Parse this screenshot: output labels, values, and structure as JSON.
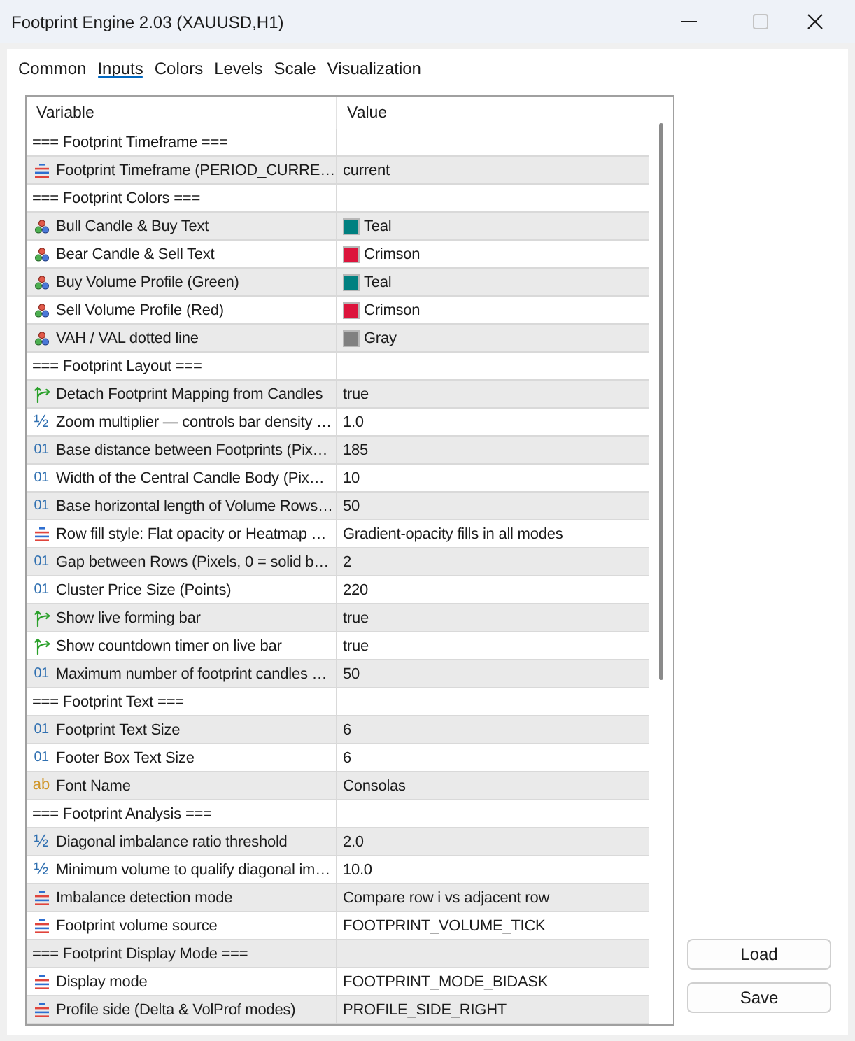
{
  "window": {
    "title": "Footprint Engine 2.03 (XAUUSD,H1)",
    "controls": [
      {
        "kind": "minimize",
        "disabled": false
      },
      {
        "kind": "maximize",
        "disabled": true
      },
      {
        "kind": "close",
        "disabled": false
      }
    ]
  },
  "tabs": [
    {
      "label": "Common",
      "selected": false
    },
    {
      "label": "Inputs",
      "selected": true
    },
    {
      "label": "Colors",
      "selected": false
    },
    {
      "label": "Levels",
      "selected": false
    },
    {
      "label": "Scale",
      "selected": false
    },
    {
      "label": "Visualization",
      "selected": false
    }
  ],
  "table": {
    "columns": [
      "Variable",
      "Value"
    ],
    "rows": [
      {
        "kind": "group",
        "variable": "=== Footprint Timeframe ==="
      },
      {
        "kind": "enum",
        "variable": "Footprint Timeframe (PERIOD_CURRE…",
        "value": "current"
      },
      {
        "kind": "group",
        "variable": "=== Footprint Colors ==="
      },
      {
        "kind": "color",
        "variable": "Bull Candle & Buy Text",
        "value": "Teal",
        "color": "#008080"
      },
      {
        "kind": "color",
        "variable": "Bear Candle & Sell Text",
        "value": "Crimson",
        "color": "#dc143c"
      },
      {
        "kind": "color",
        "variable": "Buy Volume Profile (Green)",
        "value": "Teal",
        "color": "#008080"
      },
      {
        "kind": "color",
        "variable": "Sell Volume Profile (Red)",
        "value": "Crimson",
        "color": "#dc143c"
      },
      {
        "kind": "color",
        "variable": "VAH / VAL dotted line",
        "value": "Gray",
        "color": "#808080"
      },
      {
        "kind": "group",
        "variable": "=== Footprint Layout ==="
      },
      {
        "kind": "bool",
        "variable": "Detach Footprint Mapping from Candles",
        "value": "true"
      },
      {
        "kind": "double",
        "icon": "½",
        "variable": "Zoom multiplier — controls bar density …",
        "value": "1.0"
      },
      {
        "kind": "int",
        "icon": "01",
        "variable": "Base distance between Footprints (Pix…",
        "value": "185"
      },
      {
        "kind": "int",
        "icon": "01",
        "variable": "Width of the Central Candle Body (Pix…",
        "value": "10"
      },
      {
        "kind": "int",
        "icon": "01",
        "variable": "Base horizontal length of Volume Rows…",
        "value": "50"
      },
      {
        "kind": "enum",
        "variable": "Row fill style: Flat opacity or Heatmap …",
        "value": "Gradient-opacity fills in all modes"
      },
      {
        "kind": "int",
        "icon": "01",
        "variable": "Gap between Rows (Pixels, 0 = solid b…",
        "value": "2"
      },
      {
        "kind": "int",
        "icon": "01",
        "variable": "Cluster Price Size (Points)",
        "value": "220"
      },
      {
        "kind": "bool",
        "variable": "Show live forming bar",
        "value": "true"
      },
      {
        "kind": "bool",
        "variable": "Show countdown timer on live bar",
        "value": "true"
      },
      {
        "kind": "int",
        "icon": "01",
        "variable": "Maximum number of footprint candles …",
        "value": "50"
      },
      {
        "kind": "group",
        "variable": "=== Footprint Text ==="
      },
      {
        "kind": "int",
        "icon": "01",
        "variable": "Footprint Text Size",
        "value": "6"
      },
      {
        "kind": "int",
        "icon": "01",
        "variable": "Footer Box Text Size",
        "value": "6"
      },
      {
        "kind": "string",
        "icon": "ab",
        "variable": "Font Name",
        "value": "Consolas"
      },
      {
        "kind": "group",
        "variable": "=== Footprint Analysis ==="
      },
      {
        "kind": "double",
        "icon": "½",
        "variable": "Diagonal imbalance ratio threshold",
        "value": "2.0"
      },
      {
        "kind": "double",
        "icon": "½",
        "variable": "Minimum volume to qualify diagonal im…",
        "value": "10.0"
      },
      {
        "kind": "enum",
        "variable": "Imbalance detection mode",
        "value": "Compare row i vs adjacent row"
      },
      {
        "kind": "enum",
        "variable": "Footprint volume source",
        "value": "FOOTPRINT_VOLUME_TICK"
      },
      {
        "kind": "group",
        "variable": "=== Footprint Display Mode ==="
      },
      {
        "kind": "enum",
        "variable": "Display mode",
        "value": "FOOTPRINT_MODE_BIDASK"
      },
      {
        "kind": "enum",
        "variable": "Profile side (Delta & VolProf modes)",
        "value": "PROFILE_SIDE_RIGHT"
      }
    ]
  },
  "buttons": [
    {
      "label": "Load"
    },
    {
      "label": "Save"
    }
  ]
}
